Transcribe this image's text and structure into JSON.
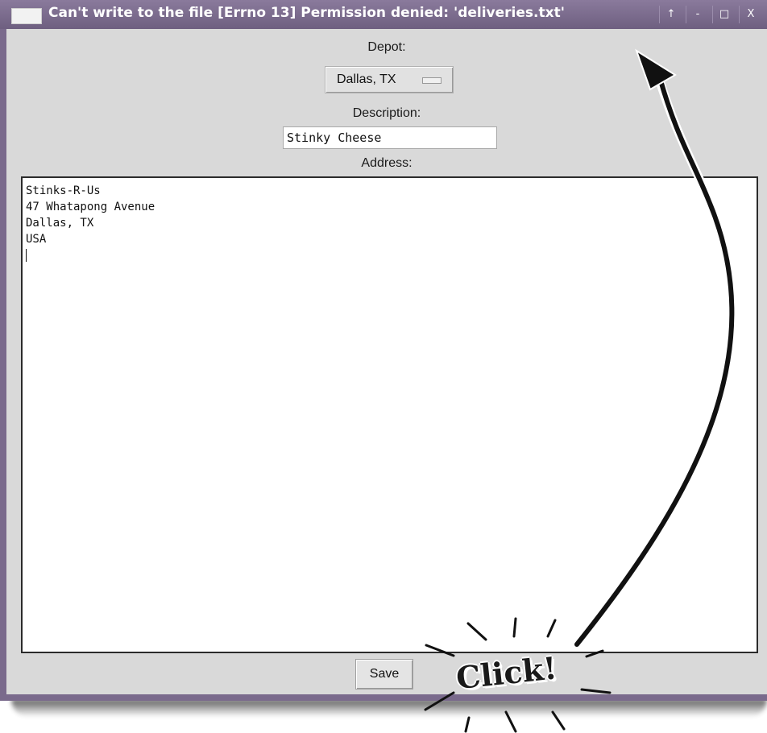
{
  "window": {
    "title": "Can't write to the file [Errno 13] Permission denied: 'deliveries.txt'",
    "controls": [
      "↑",
      "-",
      "□",
      "X"
    ]
  },
  "form": {
    "depot_label": "Depot:",
    "depot_value": "Dallas, TX",
    "description_label": "Description:",
    "description_value": "Stinky Cheese",
    "address_label": "Address:",
    "address_lines": [
      "Stinks-R-Us",
      "47 Whatapong Avenue",
      "Dallas, TX",
      "USA"
    ],
    "save_label": "Save"
  },
  "annotation": {
    "callout_text": "Click!"
  },
  "colors": {
    "titlebar": "#7a6a8c",
    "client_background": "#d9d9d9"
  }
}
